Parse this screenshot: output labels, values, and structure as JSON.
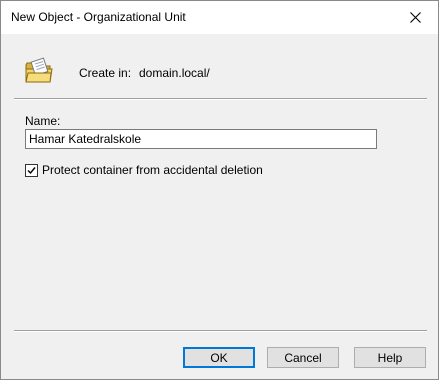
{
  "window": {
    "title": "New Object - Organizational Unit"
  },
  "header": {
    "icon": "organizational-unit-folder-icon",
    "create_in_label": "Create in:",
    "create_in_value": "domain.local/"
  },
  "form": {
    "name_label": "Name:",
    "name_value": "Hamar Katedralskole",
    "protect_label": "Protect container from accidental deletion",
    "protect_checked": true
  },
  "buttons": {
    "ok": "OK",
    "cancel": "Cancel",
    "help": "Help"
  },
  "colors": {
    "focus_border": "#0078d7",
    "dialog_bg": "#f0f0f0",
    "button_bg": "#e1e1e1"
  }
}
